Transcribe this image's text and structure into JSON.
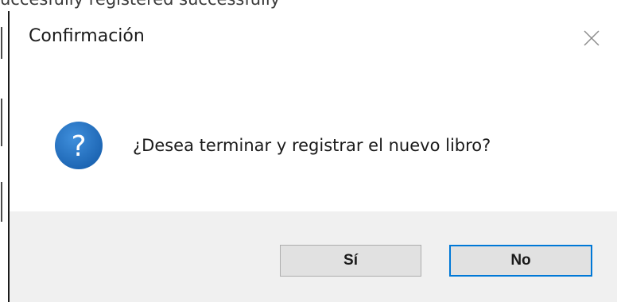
{
  "background_text": "uccesfully registered successfully",
  "dialog": {
    "title": "Confirmación",
    "close_icon": "close-icon",
    "icon": "question-icon",
    "message": "¿Desea terminar y registrar el nuevo libro?",
    "buttons": {
      "yes_label": "Sí",
      "no_label": "No"
    }
  },
  "colors": {
    "icon_blue": "#1e6fc0",
    "focus_border": "#0078d7",
    "footer_bg": "#f0f0f0",
    "button_bg": "#e1e1e1"
  }
}
